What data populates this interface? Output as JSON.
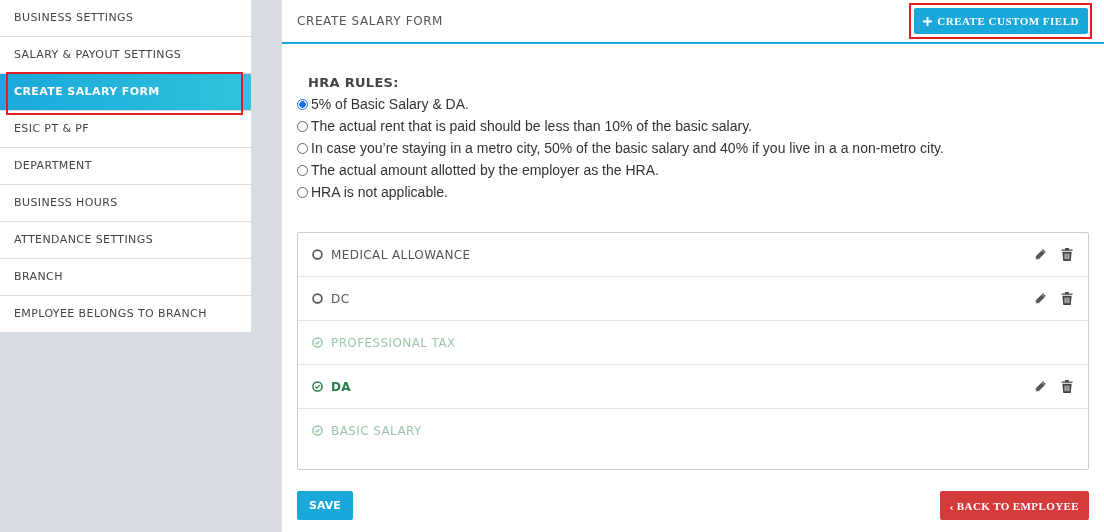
{
  "sidebar": {
    "items": [
      {
        "label": "BUSINESS SETTINGS",
        "selected": false,
        "highlighted": false
      },
      {
        "label": "SALARY & PAYOUT SETTINGS",
        "selected": false,
        "highlighted": false
      },
      {
        "label": "CREATE SALARY FORM",
        "selected": true,
        "highlighted": true
      },
      {
        "label": "ESIC PT & PF",
        "selected": false,
        "highlighted": false
      },
      {
        "label": "DEPARTMENT",
        "selected": false,
        "highlighted": false
      },
      {
        "label": "BUSINESS HOURS",
        "selected": false,
        "highlighted": false
      },
      {
        "label": "ATTENDANCE SETTINGS",
        "selected": false,
        "highlighted": false
      },
      {
        "label": "BRANCH",
        "selected": false,
        "highlighted": false
      },
      {
        "label": "EMPLOYEE BELONGS TO BRANCH",
        "selected": false,
        "highlighted": false
      }
    ]
  },
  "header": {
    "title": "CREATE SALARY FORM",
    "create_button": {
      "label": "CREATE CUSTOM FIELD",
      "highlighted": true
    }
  },
  "hra_rules": {
    "heading": "HRA RULES:",
    "options": [
      {
        "label": "5% of Basic Salary & DA.",
        "selected": true
      },
      {
        "label": "The actual rent that is paid should be less than 10% of the basic salary.",
        "selected": false
      },
      {
        "label": "In case you’re staying in a metro city, 50% of the basic salary and 40% if you live in a a non-metro city.",
        "selected": false
      },
      {
        "label": "The actual amount allotted by the employer as the HRA.",
        "selected": false
      },
      {
        "label": "HRA is not applicable.",
        "selected": false
      }
    ]
  },
  "fields": [
    {
      "label": "MEDICAL ALLOWANCE",
      "checked": false,
      "disabled": false,
      "editable": true
    },
    {
      "label": "DC",
      "checked": false,
      "disabled": false,
      "editable": true
    },
    {
      "label": "PROFESSIONAL TAX",
      "checked": true,
      "disabled": true,
      "editable": false
    },
    {
      "label": "DA",
      "checked": true,
      "disabled": false,
      "editable": true
    },
    {
      "label": "BASIC SALARY",
      "checked": true,
      "disabled": true,
      "editable": false
    }
  ],
  "buttons": {
    "save": "SAVE",
    "back": {
      "caret": "‹",
      "label": "BACK TO EMPLOYEE"
    }
  }
}
